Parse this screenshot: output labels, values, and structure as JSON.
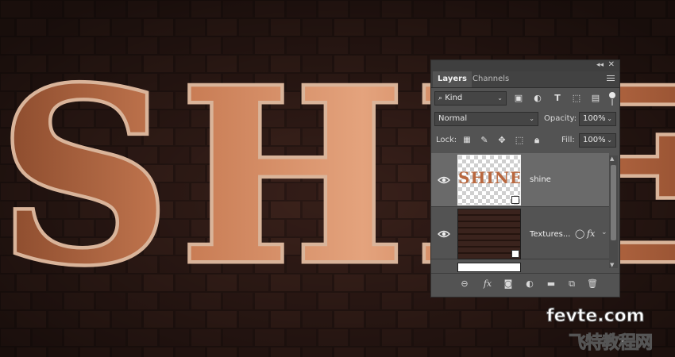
{
  "artwork": {
    "text": "SHIE"
  },
  "panel": {
    "tabs": [
      {
        "label": "Layers"
      },
      {
        "label": "Channels"
      }
    ],
    "filter": {
      "kind_label": "Kind"
    },
    "blend": {
      "mode": "Normal",
      "opacity_label": "Opacity:",
      "opacity_value": "100%"
    },
    "lock": {
      "label": "Lock:",
      "fill_label": "Fill:",
      "fill_value": "100%"
    },
    "layers": [
      {
        "name": "shine",
        "thumb_text": "SHINE",
        "selected": true
      },
      {
        "name": "Textures...",
        "fx": "fx"
      }
    ]
  },
  "icons": {
    "filter": "search-icon",
    "filter_types": [
      "image-filter-icon",
      "adjustment-filter-icon",
      "type-filter-icon",
      "shape-filter-icon",
      "smart-object-filter-icon"
    ],
    "bottom": [
      "link-icon",
      "fx-icon",
      "mask-icon",
      "adjustment-icon",
      "folder-icon",
      "new-layer-icon",
      "trash-icon"
    ]
  },
  "watermark": {
    "line1": "fevte.com",
    "line2": "飞特教程网"
  }
}
